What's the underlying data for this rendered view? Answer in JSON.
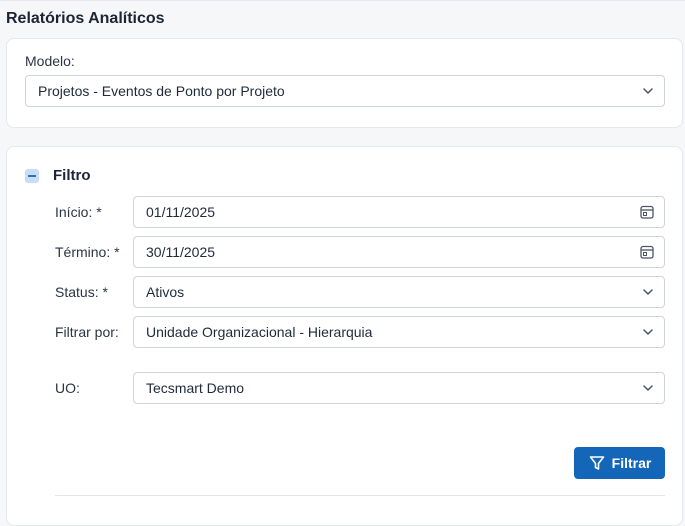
{
  "page": {
    "title": "Relatórios Analíticos"
  },
  "model": {
    "label": "Modelo:",
    "value": "Projetos - Eventos de Ponto por Projeto"
  },
  "filter": {
    "title": "Filtro",
    "fields": {
      "start": {
        "label": "Início: *",
        "value": "01/11/2025"
      },
      "end": {
        "label": "Término: *",
        "value": "30/11/2025"
      },
      "status": {
        "label": "Status: *",
        "value": "Ativos"
      },
      "filter_by": {
        "label": "Filtrar por:",
        "value": "Unidade Organizacional - Hierarquia"
      },
      "uo": {
        "label": "UO:",
        "value": "Tecsmart Demo"
      }
    },
    "submit_label": "Filtrar"
  },
  "colors": {
    "primary": "#1466b8",
    "collapse_bg": "#c9dcf5",
    "border": "#cfd4dc"
  },
  "icons": [
    "chevron-down-icon",
    "calendar-icon",
    "minus-icon",
    "filter-icon"
  ]
}
